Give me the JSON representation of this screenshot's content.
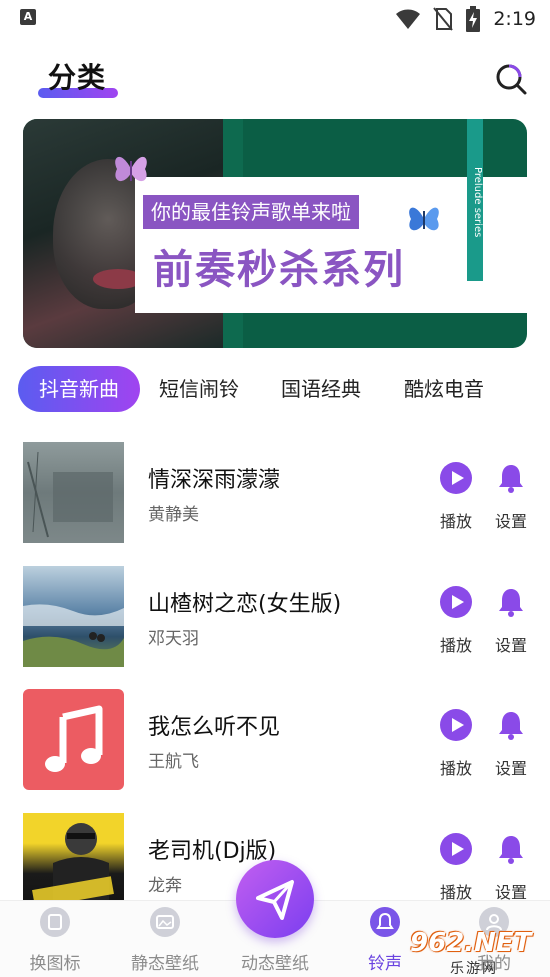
{
  "status_bar": {
    "time": "2:19",
    "icons": [
      "a-icon",
      "wifi-icon",
      "no-sim-icon",
      "battery-charging-icon"
    ]
  },
  "header": {
    "title": "分类",
    "search_icon": "search-icon"
  },
  "banner": {
    "tagline": "你的最佳铃声歌单来啦",
    "headline": "前奏秒杀系列",
    "side_text": "Prelude series"
  },
  "tabs": [
    {
      "label": "抖音新曲",
      "active": true
    },
    {
      "label": "短信闹铃",
      "active": false
    },
    {
      "label": "国语经典",
      "active": false
    },
    {
      "label": "酷炫电音",
      "active": false
    }
  ],
  "songs": [
    {
      "title": "情深深雨濛濛",
      "artist": "黄静美",
      "play_label": "播放",
      "set_label": "设置"
    },
    {
      "title": "山楂树之恋(女生版)",
      "artist": "邓天羽",
      "play_label": "播放",
      "set_label": "设置"
    },
    {
      "title": "我怎么听不见",
      "artist": "王航飞",
      "play_label": "播放",
      "set_label": "设置"
    },
    {
      "title": "老司机(Dj版)",
      "artist": "龙奔",
      "play_label": "播放",
      "set_label": "设置"
    }
  ],
  "bottom_nav": [
    {
      "label": "换图标",
      "icon": "change-icon-icon",
      "active": false
    },
    {
      "label": "静态壁纸",
      "icon": "image-icon",
      "active": false
    },
    {
      "label": "动态壁纸",
      "icon": "send-icon",
      "active": false
    },
    {
      "label": "铃声",
      "icon": "bell-icon",
      "active": true
    },
    {
      "label": "我的",
      "icon": "user-icon",
      "active": false
    }
  ],
  "watermark": {
    "main": "962.NET",
    "sub": "乐游网"
  },
  "colors": {
    "accent_start": "#5b5cf0",
    "accent_end": "#a044f0",
    "purple": "#8a55c2",
    "banner_green": "#0b5e45"
  }
}
